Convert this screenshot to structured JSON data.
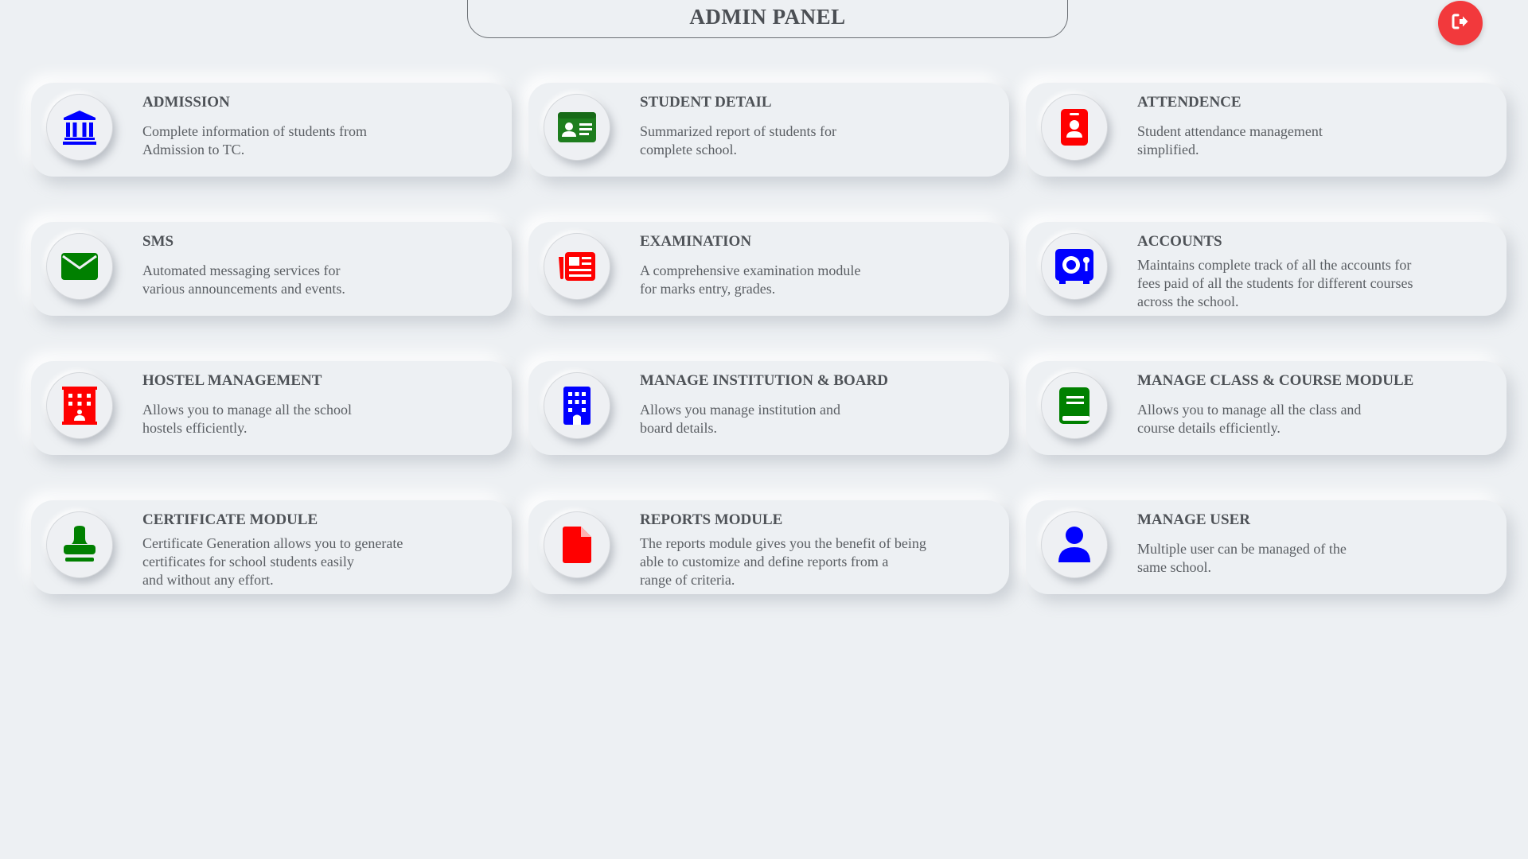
{
  "header": {
    "title": "ADMIN PANEL"
  },
  "logout": {
    "icon": "logout-icon",
    "color": "#f2393c"
  },
  "modules": [
    {
      "title": "ADMISSION",
      "icon": "bank-icon",
      "color": "#0000ff",
      "lines": [
        "Complete information of students from",
        "Admission to TC."
      ]
    },
    {
      "title": "STUDENT DETAIL",
      "icon": "id-card-icon",
      "color": "#1e7e1e",
      "lines": [
        "Summarized report of students for",
        "complete school."
      ]
    },
    {
      "title": "ATTENDENCE",
      "icon": "id-badge-icon",
      "color": "#ff0000",
      "lines": [
        "Student attendance management",
        "simplified."
      ]
    },
    {
      "title": "SMS",
      "icon": "envelope-icon",
      "color": "#008000",
      "lines": [
        "Automated messaging services for",
        "various announcements and events."
      ]
    },
    {
      "title": "EXAMINATION",
      "icon": "newspaper-icon",
      "color": "#ff0000",
      "lines": [
        "A comprehensive examination module",
        "for marks entry, grades."
      ]
    },
    {
      "title": "ACCOUNTS",
      "icon": "safe-icon",
      "color": "#0000ff",
      "lines": [
        "Maintains complete track of all the accounts for",
        "fees paid of all the students for different courses",
        "across the school."
      ]
    },
    {
      "title": "HOSTEL MANAGEMENT",
      "icon": "hotel-icon",
      "color": "#ff0000",
      "lines": [
        "Allows you to manage all the school",
        "hostels efficiently."
      ]
    },
    {
      "title": "MANAGE INSTITUTION & BOARD",
      "icon": "building-icon",
      "color": "#0000ff",
      "lines": [
        "Allows you manage institution and",
        "board details."
      ]
    },
    {
      "title": "MANAGE CLASS & COURSE MODULE",
      "icon": "book-icon",
      "color": "#008000",
      "lines": [
        "Allows you to manage all the class and",
        "course details efficiently."
      ]
    },
    {
      "title": "CERTIFICATE MODULE",
      "icon": "stamp-icon",
      "color": "#008000",
      "lines": [
        "Certificate Generation allows you to generate",
        "certificates for school students easily",
        "and without any effort."
      ]
    },
    {
      "title": "REPORTS MODULE",
      "icon": "file-icon",
      "color": "#ff0000",
      "lines": [
        "The reports module gives you the benefit of being",
        "able to customize and define reports from a",
        "range of criteria."
      ]
    },
    {
      "title": "MANAGE USER",
      "icon": "user-icon",
      "color": "#0000ff",
      "lines": [
        "Multiple user can be managed of the",
        "same school."
      ]
    }
  ]
}
